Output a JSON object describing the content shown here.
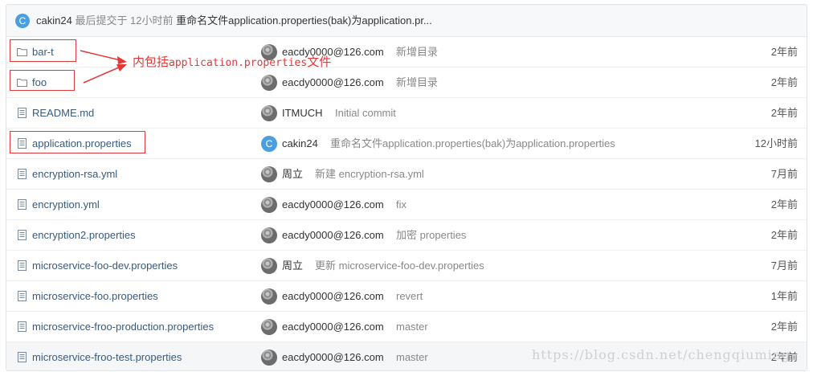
{
  "header": {
    "avatar_letter": "C",
    "author": "cakin24",
    "meta": "最后提交于 12小时前",
    "message": "重命名文件application.properties(bak)为application.pr..."
  },
  "files": [
    {
      "type": "folder",
      "name": "bar-t",
      "avatar": "photo",
      "author": "eacdy0000@126.com",
      "message": "新增目录",
      "time": "2年前",
      "highlighted": true
    },
    {
      "type": "folder",
      "name": "foo",
      "avatar": "photo",
      "author": "eacdy0000@126.com",
      "message": "新增目录",
      "time": "2年前",
      "highlighted": true
    },
    {
      "type": "file",
      "name": "README.md",
      "avatar": "photo",
      "author": "ITMUCH",
      "message": "Initial commit",
      "time": "2年前",
      "highlighted": false
    },
    {
      "type": "file",
      "name": "application.properties",
      "avatar": "C",
      "author": "cakin24",
      "message": "重命名文件application.properties(bak)为application.properties",
      "time": "12小时前",
      "highlighted": true
    },
    {
      "type": "file",
      "name": "encryption-rsa.yml",
      "avatar": "photo",
      "author": "周立",
      "message": "新建 encryption-rsa.yml",
      "time": "7月前",
      "highlighted": false
    },
    {
      "type": "file",
      "name": "encryption.yml",
      "avatar": "photo",
      "author": "eacdy0000@126.com",
      "message": "fix",
      "time": "2年前",
      "highlighted": false
    },
    {
      "type": "file",
      "name": "encryption2.properties",
      "avatar": "photo",
      "author": "eacdy0000@126.com",
      "message": "加密 properties",
      "time": "2年前",
      "highlighted": false
    },
    {
      "type": "file",
      "name": "microservice-foo-dev.properties",
      "avatar": "photo",
      "author": "周立",
      "message": "更新 microservice-foo-dev.properties",
      "time": "7月前",
      "highlighted": false
    },
    {
      "type": "file",
      "name": "microservice-foo.properties",
      "avatar": "photo",
      "author": "eacdy0000@126.com",
      "message": "revert",
      "time": "1年前",
      "highlighted": false
    },
    {
      "type": "file",
      "name": "microservice-froo-production.properties",
      "avatar": "photo",
      "author": "eacdy0000@126.com",
      "message": "master",
      "time": "2年前",
      "highlighted": false
    },
    {
      "type": "file",
      "name": "microservice-froo-test.properties",
      "avatar": "photo",
      "author": "eacdy0000@126.com",
      "message": "master",
      "time": "2年前",
      "highlighted": false
    }
  ],
  "annotation": {
    "prefix": "内包括",
    "mono": "application.properties",
    "suffix": "文件"
  },
  "watermark": "https://blog.csdn.net/chengqiuming",
  "colors": {
    "annotation_red": "#e0393a",
    "link_blue": "#3a5a7d",
    "avatar_blue": "#4a9fe0"
  }
}
